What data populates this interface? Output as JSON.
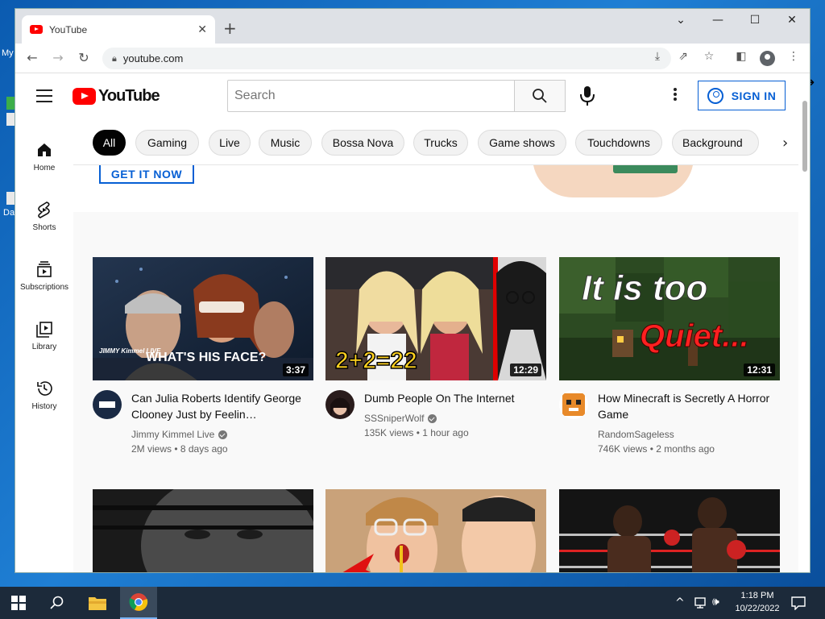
{
  "desktop": {
    "labels": [
      "My",
      "Da"
    ]
  },
  "browser": {
    "tab_title": "YouTube",
    "tab_close": "✕",
    "new_tab": "+",
    "url": "youtube.com",
    "window_controls": [
      "⌄",
      "—",
      "☐",
      "✕"
    ]
  },
  "youtube": {
    "search_placeholder": "Search",
    "sign_in": "SIGN IN",
    "chips": [
      "All",
      "Gaming",
      "Live",
      "Music",
      "Bossa Nova",
      "Trucks",
      "Game shows",
      "Touchdowns",
      "Background"
    ],
    "sidebar": [
      {
        "label": "Home",
        "icon": "home-icon"
      },
      {
        "label": "Shorts",
        "icon": "shorts-icon"
      },
      {
        "label": "Subscriptions",
        "icon": "subscriptions-icon"
      },
      {
        "label": "Library",
        "icon": "library-icon"
      },
      {
        "label": "History",
        "icon": "history-icon"
      }
    ],
    "banner_button": "GET IT NOW",
    "videos": [
      {
        "title": "Can Julia Roberts Identify George Clooney Just by Feelin…",
        "channel": "Jimmy Kimmel Live",
        "verified": true,
        "stats": "2M views • 8 days ago",
        "duration": "3:37",
        "thumb_text": "WHAT'S HIS FACE?",
        "thumb_brand": "JIMMY Kimmel LIVE"
      },
      {
        "title": "Dumb People On The Internet",
        "channel": "SSSniperWolf",
        "verified": true,
        "stats": "135K views • 1 hour ago",
        "duration": "12:29",
        "thumb_text": "2+2=22"
      },
      {
        "title": "How Minecraft is Secretly A Horror Game",
        "channel": "RandomSageless",
        "verified": false,
        "stats": "746K views • 2 months ago",
        "duration": "12:31",
        "thumb_text_1": "It is too",
        "thumb_text_2": "Quiet..."
      }
    ]
  },
  "taskbar": {
    "time": "1:18 PM",
    "date": "10/22/2022"
  }
}
